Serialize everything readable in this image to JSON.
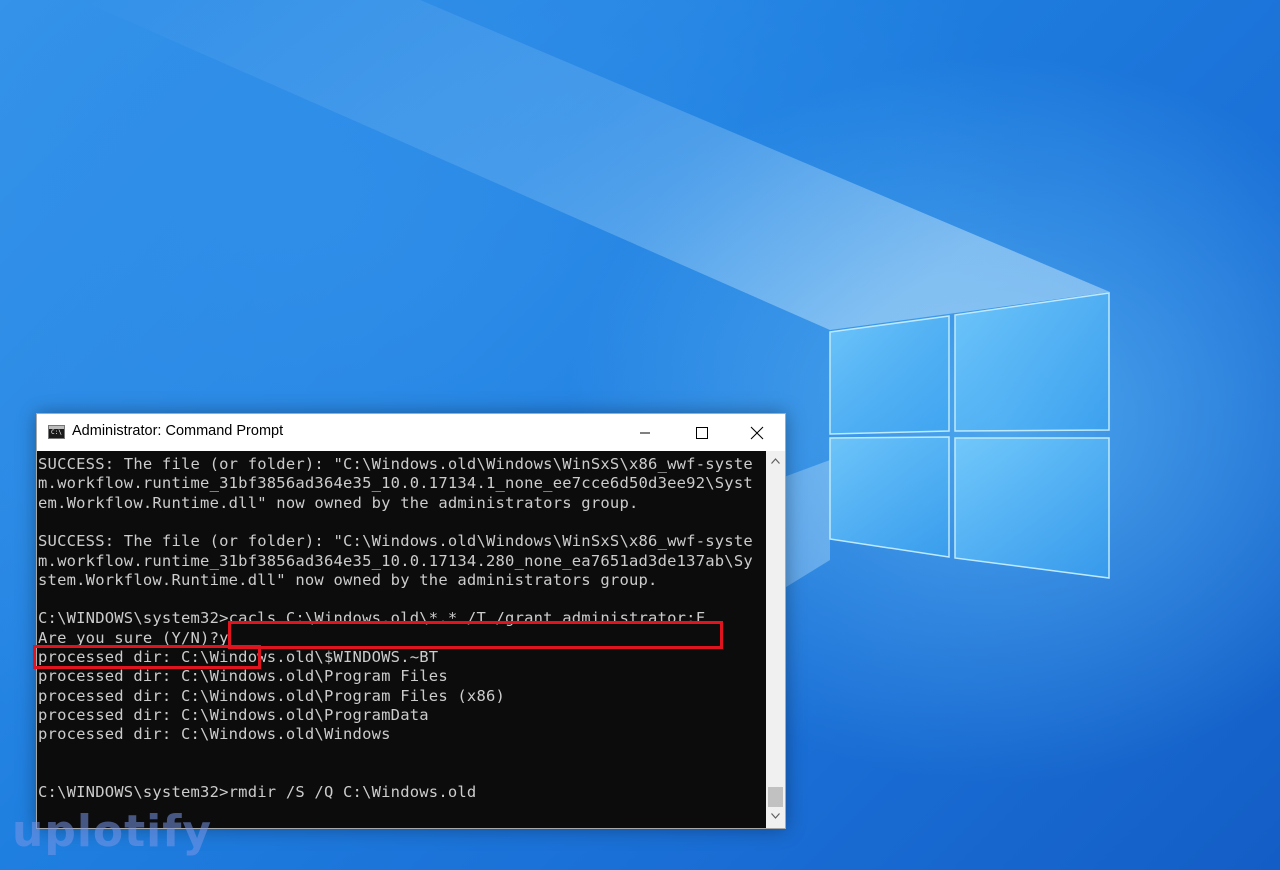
{
  "window": {
    "title": "Administrator: Command Prompt",
    "icon_label": "C:\\"
  },
  "console": {
    "lines": [
      "SUCCESS: The file (or folder): \"C:\\Windows.old\\Windows\\WinSxS\\x86_wwf-syste",
      "m.workflow.runtime_31bf3856ad364e35_10.0.17134.1_none_ee7cce6d50d3ee92\\Syst",
      "em.Workflow.Runtime.dll\" now owned by the administrators group.",
      "",
      "SUCCESS: The file (or folder): \"C:\\Windows.old\\Windows\\WinSxS\\x86_wwf-syste",
      "m.workflow.runtime_31bf3856ad364e35_10.0.17134.280_none_ea7651ad3de137ab\\Sy",
      "stem.Workflow.Runtime.dll\" now owned by the administrators group.",
      "",
      "C:\\WINDOWS\\system32>cacls C:\\Windows.old\\*.* /T /grant administrator:F",
      "Are you sure (Y/N)?y",
      "processed dir: C:\\Windows.old\\$WINDOWS.~BT",
      "processed dir: C:\\Windows.old\\Program Files",
      "processed dir: C:\\Windows.old\\Program Files (x86)",
      "processed dir: C:\\Windows.old\\ProgramData",
      "processed dir: C:\\Windows.old\\Windows",
      "",
      "",
      "C:\\WINDOWS\\system32>rmdir /S /Q C:\\Windows.old"
    ]
  },
  "watermark": "uplotify",
  "colors": {
    "highlight": "#e0141e",
    "console_bg": "#0c0c0c",
    "console_text": "#cccccc",
    "desktop_blue": "#1e6fd6"
  },
  "icons": {
    "app": "cmd-icon",
    "minimize": "minimize-icon",
    "maximize": "maximize-icon",
    "close": "close-icon",
    "windows_logo": "windows-logo"
  }
}
